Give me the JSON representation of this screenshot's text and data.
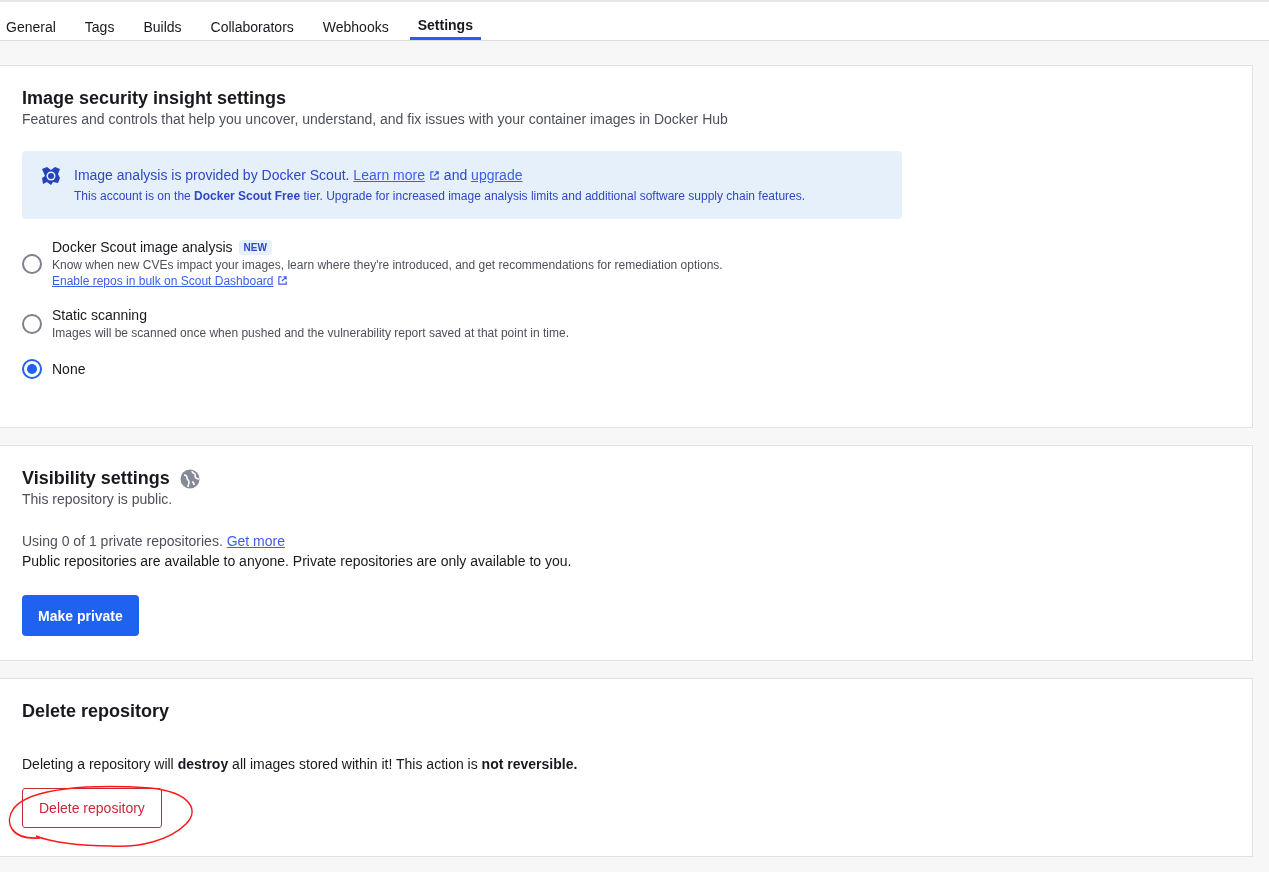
{
  "tabs": [
    {
      "label": "General",
      "selected": false
    },
    {
      "label": "Tags",
      "selected": false
    },
    {
      "label": "Builds",
      "selected": false
    },
    {
      "label": "Collaborators",
      "selected": false
    },
    {
      "label": "Webhooks",
      "selected": false
    },
    {
      "label": "Settings",
      "selected": true
    }
  ],
  "image_security": {
    "title": "Image security insight settings",
    "subtitle": "Features and controls that help you uncover, understand, and fix issues with your container images in Docker Hub",
    "banner": {
      "headline": [
        {
          "kind": "text",
          "text": "Image analysis is provided by Docker Scout. "
        },
        {
          "kind": "link",
          "text": "Learn more",
          "external": true
        },
        {
          "kind": "text",
          "text": " and "
        },
        {
          "kind": "link",
          "text": "upgrade",
          "external": false
        }
      ],
      "note": "This account is on the **Docker Scout Free** tier. Upgrade for increased image analysis limits and additional software supply chain features."
    },
    "options": [
      {
        "label": "Docker Scout image analysis",
        "badge": "NEW",
        "selected": false,
        "description": [
          {
            "kind": "text",
            "text": "Know when new CVEs impact your images, learn where they're introduced, and get recommendations for remediation options. "
          },
          {
            "kind": "link",
            "text": "Enable repos in bulk on Scout Dashboard",
            "external": true
          }
        ]
      },
      {
        "label": "Static scanning",
        "selected": false,
        "description": [
          {
            "kind": "text",
            "text": "Images will be scanned once when pushed and the vulnerability report saved at that point in time."
          }
        ]
      },
      {
        "label": "None",
        "selected": true
      }
    ]
  },
  "visibility": {
    "title": "Visibility settings",
    "subtitle": "This repository is public.",
    "usage": [
      {
        "kind": "text",
        "text": "Using 0 of 1 private repositories. "
      },
      {
        "kind": "link",
        "text": "Get more",
        "external": false
      }
    ],
    "info": "Public repositories are available to anyone. Private repositories are only available to you.",
    "button": "Make private"
  },
  "delete": {
    "title": "Delete repository",
    "warning": "Deleting a repository will **destroy** all images stored within it! This action is **not reversible.**",
    "button": "Delete repository"
  }
}
